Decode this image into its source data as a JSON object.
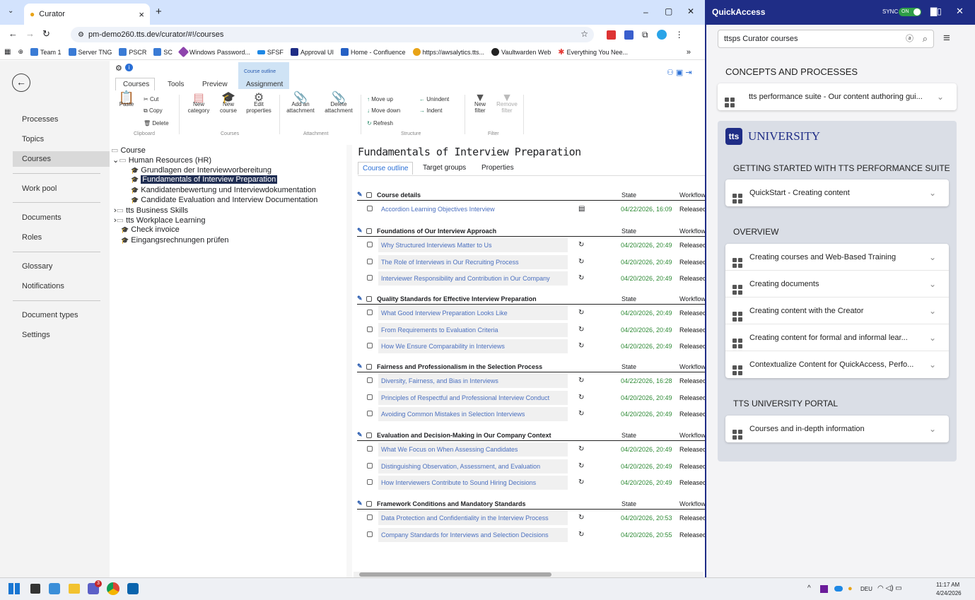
{
  "browser": {
    "tab_title": "Curator",
    "tab_close": "×",
    "new_tab": "+",
    "url": "pm-demo260.tts.dev/curator/#!/courses",
    "bookmarks": [
      "Team 1",
      "Server TNG",
      "PSCR",
      "SC",
      "Windows Password...",
      "SFSF",
      "Approval UI",
      "Home - Confluence",
      "https://awsalytics.tts...",
      "Vaultwarden Web",
      "Everything You Nee..."
    ],
    "more": "»",
    "win_min": "–",
    "win_max": "▢",
    "win_close": "✕"
  },
  "nav": {
    "items": [
      "Processes",
      "Topics",
      "Courses",
      "Work pool",
      "Documents",
      "Roles",
      "Glossary",
      "Notifications",
      "Document types",
      "Settings"
    ]
  },
  "ribbon": {
    "tabs": [
      "Courses",
      "Tools",
      "Preview",
      "Assignment"
    ],
    "context_label": "Course outline",
    "paste": "Paste",
    "cut": "Cut",
    "copy": "Copy",
    "delete": "Delete",
    "clipboard": "Clipboard",
    "new_category": [
      "New",
      "category"
    ],
    "new_course": [
      "New",
      "course"
    ],
    "edit_properties": [
      "Edit",
      "properties"
    ],
    "courses_group": "Courses",
    "add_attachment": [
      "Add an",
      "attachment"
    ],
    "delete_attachment": [
      "Delete",
      "attachment"
    ],
    "attachment_group": "Attachment",
    "move_up": "Move up",
    "move_down": "Move down",
    "refresh": "Refresh",
    "unindent": "Unindent",
    "indent": "Indent",
    "structure_group": "Structure",
    "new_filter": [
      "New",
      "filter"
    ],
    "remove_filter": [
      "Remove",
      "filter"
    ],
    "filter_group": "Filter"
  },
  "tree": {
    "nodes": [
      "Course",
      "Human Resources (HR)",
      "Grundlagen der Interviewvorbereitung",
      "Fundamentals of Interview Preparation",
      "Kandidatenbewertung und Interviewdokumentation",
      "Candidate Evaluation and Interview Documentation",
      "tts Business Skills",
      "tts Workplace Learning",
      "Check invoice",
      "Eingangsrechnungen prüfen"
    ]
  },
  "content": {
    "title": "Fundamentals of Interview Preparation",
    "tabs": [
      "Course outline",
      "Target groups",
      "Properties"
    ],
    "state_label": "State",
    "workflow_label": "Workflow",
    "sections": [
      {
        "title": "Course details",
        "rows": [
          {
            "label": "Accordion Learning Objectives Interview",
            "date": "04/22/2026, 16:09",
            "wf": "Released"
          }
        ]
      },
      {
        "title": "Foundations of Our Interview Approach",
        "rows": [
          {
            "label": "Why Structured Interviews Matter to Us",
            "date": "04/20/2026, 20:49",
            "wf": "Released"
          },
          {
            "label": "The Role of Interviews in Our Recruiting Process",
            "date": "04/20/2026, 20:49",
            "wf": "Released"
          },
          {
            "label": "Interviewer Responsibility and Contribution in Our Company",
            "date": "04/20/2026, 20:49",
            "wf": "Released"
          }
        ]
      },
      {
        "title": "Quality Standards for Effective Interview Preparation",
        "rows": [
          {
            "label": "What Good Interview Preparation Looks Like",
            "date": "04/20/2026, 20:49",
            "wf": "Released"
          },
          {
            "label": "From Requirements to Evaluation Criteria",
            "date": "04/20/2026, 20:49",
            "wf": "Released"
          },
          {
            "label": "How We Ensure Comparability in Interviews",
            "date": "04/20/2026, 20:49",
            "wf": "Released"
          }
        ]
      },
      {
        "title": "Fairness and Professionalism in the Selection Process",
        "rows": [
          {
            "label": "Diversity, Fairness, and Bias in Interviews",
            "date": "04/22/2026, 16:28",
            "wf": "Released"
          },
          {
            "label": "Principles of Respectful and Professional Interview Conduct",
            "date": "04/20/2026, 20:49",
            "wf": "Released"
          },
          {
            "label": "Avoiding Common Mistakes in Selection Interviews",
            "date": "04/20/2026, 20:49",
            "wf": "Released"
          }
        ]
      },
      {
        "title": "Evaluation and Decision-Making in Our Company Context",
        "rows": [
          {
            "label": "What We Focus on When Assessing Candidates",
            "date": "04/20/2026, 20:49",
            "wf": "Released"
          },
          {
            "label": "Distinguishing Observation, Assessment, and Evaluation",
            "date": "04/20/2026, 20:49",
            "wf": "Released"
          },
          {
            "label": "How Interviewers Contribute to Sound Hiring Decisions",
            "date": "04/20/2026, 20:49",
            "wf": "Released"
          }
        ]
      },
      {
        "title": "Framework Conditions and Mandatory Standards",
        "rows": [
          {
            "label": "Data Protection and Confidentiality in the Interview Process",
            "date": "04/20/2026, 20:53",
            "wf": "Released"
          },
          {
            "label": "Company Standards for Interviews and Selection Decisions",
            "date": "04/20/2026, 20:55",
            "wf": "Released"
          }
        ]
      }
    ]
  },
  "quickaccess": {
    "title": "QuickAccess",
    "sync": "SYNC",
    "sync_state": "ON",
    "search_value": "ttsps Curator courses",
    "concepts_heading": "CONCEPTS AND PROCESSES",
    "concepts_item": "tts performance suite - Our content authoring gui...",
    "univ_logo": "tts",
    "univ_title": "UNIVERSITY",
    "getting_started_heading": "GETTING STARTED WITH TTS PERFORMANCE SUITE",
    "getting_started_item": "QuickStart - Creating content",
    "overview_heading": "OVERVIEW",
    "overview_items": [
      "Creating courses and Web-Based Training",
      "Creating documents",
      "Creating content with the Creator",
      "Creating content for formal and informal lear...",
      "Contextualize Content for QuickAccess, Perfo..."
    ],
    "portal_heading": "TTS UNIVERSITY PORTAL",
    "portal_item": "Courses and in-depth information"
  },
  "taskbar": {
    "lang": "DEU",
    "time": "11:17 AM",
    "date": "4/24/2026",
    "badge": "3"
  },
  "colors": {
    "accent": "#1f2d86",
    "released_green": "#2e8a35",
    "link_blue": "#4a6fbf"
  }
}
